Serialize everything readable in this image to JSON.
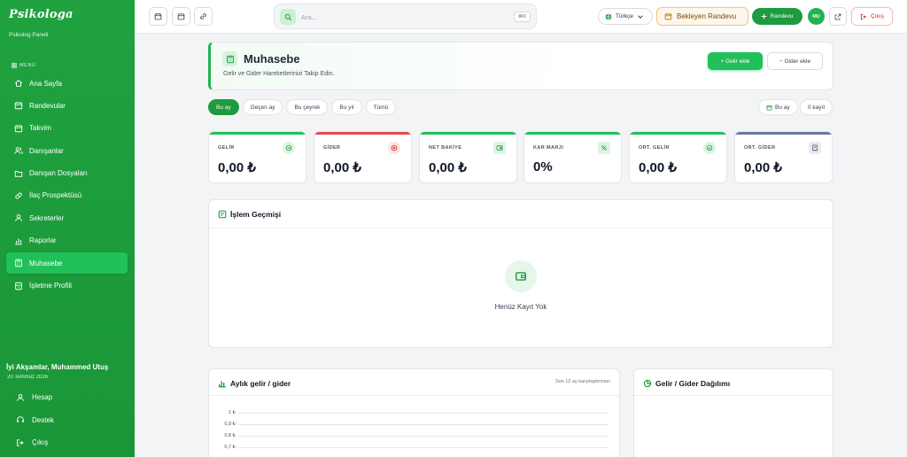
{
  "brand": {
    "name": "Psikologa",
    "subtitle": "Psikolog Paneli"
  },
  "sidebar": {
    "menu_heading": "MENÜ",
    "items": [
      {
        "label": "Ana Sayfa",
        "icon": "home-icon",
        "active": false
      },
      {
        "label": "Randevular",
        "icon": "calendar-icon",
        "active": false
      },
      {
        "label": "Takvim",
        "icon": "calendar-icon",
        "active": false
      },
      {
        "label": "Danışanlar",
        "icon": "users-icon",
        "active": false
      },
      {
        "label": "Danışan Dosyaları",
        "icon": "folder-icon",
        "active": false
      },
      {
        "label": "İlaç Prospektüsü",
        "icon": "pill-icon",
        "active": false
      },
      {
        "label": "Sekreterler",
        "icon": "user-icon",
        "active": false
      },
      {
        "label": "Raporlar",
        "icon": "chart-icon",
        "active": false
      },
      {
        "label": "Muhasebe",
        "icon": "calculator-icon",
        "active": true
      },
      {
        "label": "İşletme Profili",
        "icon": "building-icon",
        "active": false
      }
    ],
    "greeting": "İyi Akşamlar, Muhammed Utuş",
    "date": "20 Temmuz 2026",
    "footer_items": [
      {
        "label": "Hesap",
        "icon": "user-icon"
      },
      {
        "label": "Destek",
        "icon": "headset-icon"
      },
      {
        "label": "Çıkış",
        "icon": "logout-icon"
      }
    ]
  },
  "topbar": {
    "search_placeholder": "Ara...",
    "search_shortcut": "⌘K",
    "language": "Türkçe",
    "pending_label": "Bekleyen Randevu",
    "new_appointment_label": "Randevu",
    "avatar_initials": "MU",
    "logout_label": "Çıkış"
  },
  "page": {
    "title": "Muhasebe",
    "subtitle": "Gelir ve Gider Hareketlerinizi Takip Edin.",
    "add_income_label": "+ Gelir ekle",
    "add_expense_label": "− Gider ekle"
  },
  "filters": {
    "periods": [
      "Bu ay",
      "Geçen ay",
      "Bu çeyrek",
      "Bu yıl",
      "Tümü"
    ],
    "selected": "Bu ay",
    "current_period_label": "Bu ay",
    "record_count": "0 kayıt"
  },
  "stats": [
    {
      "label": "GELİR",
      "value": "0,00 ₺",
      "color": "#22c05a",
      "icon": "trend-up-icon"
    },
    {
      "label": "GİDER",
      "value": "0,00 ₺",
      "color": "#e5484d",
      "icon": "x-circle-icon"
    },
    {
      "label": "NET BAKİYE",
      "value": "0,00 ₺",
      "color": "#22c05a",
      "icon": "wallet-icon"
    },
    {
      "label": "KAR MARJI",
      "value": "0%",
      "color": "#22c05a",
      "icon": "percent-icon"
    },
    {
      "label": "ORT. GELİR",
      "value": "0,00 ₺",
      "color": "#22c05a",
      "icon": "check-circle-icon"
    },
    {
      "label": "ORT. GİDER",
      "value": "0,00 ₺",
      "color": "#6b7a99",
      "icon": "receipt-icon"
    }
  ],
  "history": {
    "title": "İşlem Geçmişi",
    "empty_text": "Henüz Kayıt Yok"
  },
  "monthly_chart": {
    "title": "Aylık gelir / gider",
    "note": "Son 12 ay karşılaştırması",
    "y_ticks": [
      "1 ₺",
      "0,9 ₺",
      "0,8 ₺",
      "0,7 ₺"
    ]
  },
  "distribution": {
    "title": "Gelir / Gider Dağılımı"
  },
  "colors": {
    "brand": "#1fa23f",
    "accent": "#22c05a",
    "danger": "#dc2626"
  }
}
